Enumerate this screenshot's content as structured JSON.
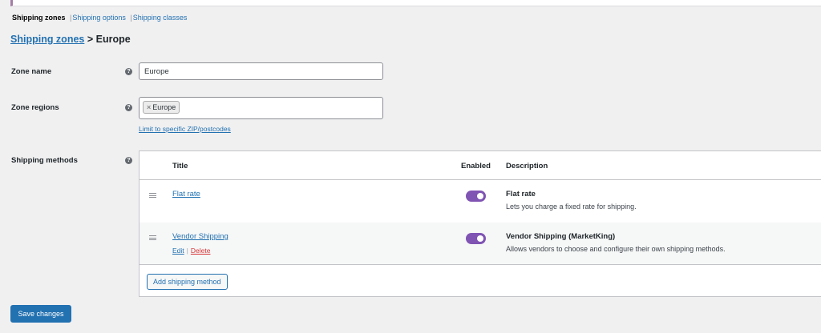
{
  "tabs": {
    "current": "Shipping zones",
    "options": "Shipping options",
    "classes": "Shipping classes",
    "separator": "|"
  },
  "breadcrumb": {
    "link": "Shipping zones",
    "separator": ">",
    "current": "Europe"
  },
  "zone_name": {
    "label": "Zone name",
    "value": "Europe"
  },
  "zone_regions": {
    "label": "Zone regions",
    "tags": [
      "Europe"
    ],
    "remove_glyph": "×",
    "limit_link": "Limit to specific ZIP/postcodes"
  },
  "shipping_methods": {
    "label": "Shipping methods",
    "columns": {
      "title": "Title",
      "enabled": "Enabled",
      "description": "Description"
    },
    "rows": [
      {
        "title": "Flat rate",
        "enabled": true,
        "desc_title": "Flat rate",
        "desc_text": "Lets you charge a fixed rate for shipping."
      },
      {
        "title": "Vendor Shipping",
        "enabled": true,
        "desc_title": "Vendor Shipping (MarketKing)",
        "desc_text": "Allows vendors to choose and configure their own shipping methods.",
        "actions": {
          "edit": "Edit",
          "separator": "|",
          "delete": "Delete"
        }
      }
    ],
    "add_button": "Add shipping method"
  },
  "save_button": "Save changes",
  "help_glyph": "?",
  "colors": {
    "accent": "#2271b1",
    "toggle_on": "#7f54b3",
    "delete": "#d63638"
  },
  "icons": {
    "help": "help-icon",
    "drag": "drag-handle-icon",
    "remove": "remove-tag-icon"
  }
}
